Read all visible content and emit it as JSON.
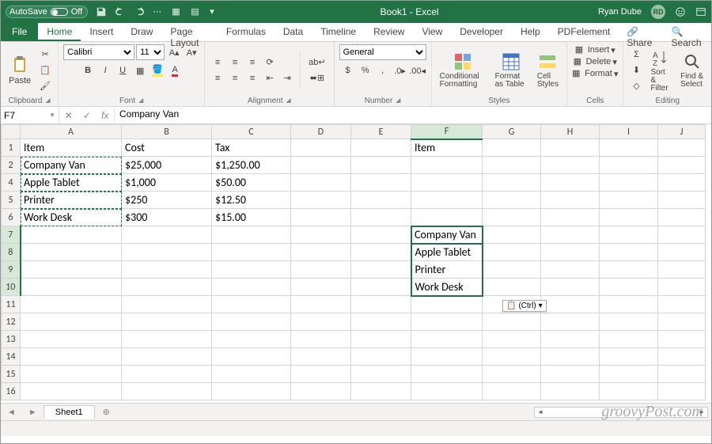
{
  "titlebar": {
    "autosave_label": "AutoSave",
    "autosave_state": "Off",
    "title": "Book1 - Excel",
    "user_name": "Ryan Dube",
    "user_initials": "RD"
  },
  "tabs": {
    "file": "File",
    "items": [
      "Home",
      "Insert",
      "Draw",
      "Page Layout",
      "Formulas",
      "Data",
      "Timeline",
      "Review",
      "View",
      "Developer",
      "Help",
      "PDFelement"
    ],
    "active": "Home",
    "share": "Share",
    "search": "Search"
  },
  "ribbon": {
    "clipboard": {
      "label": "Clipboard",
      "paste": "Paste"
    },
    "font": {
      "label": "Font",
      "name": "Calibri",
      "size": "11"
    },
    "alignment": {
      "label": "Alignment"
    },
    "number": {
      "label": "Number",
      "format": "General"
    },
    "styles": {
      "label": "Styles",
      "cond": "Conditional Formatting",
      "table": "Format as Table",
      "cell": "Cell Styles"
    },
    "cells": {
      "label": "Cells",
      "insert": "Insert",
      "delete": "Delete",
      "format": "Format"
    },
    "editing": {
      "label": "Editing",
      "sort": "Sort & Filter",
      "find": "Find & Select"
    }
  },
  "formula_bar": {
    "name_box": "F7",
    "fx": "fx",
    "value": "Company Van"
  },
  "columns": [
    "A",
    "B",
    "C",
    "D",
    "E",
    "F",
    "G",
    "H",
    "I",
    "J"
  ],
  "rows": [
    "1",
    "2",
    "4",
    "5",
    "6",
    "7",
    "8",
    "9",
    "10",
    "11",
    "12",
    "13",
    "14",
    "15",
    "16"
  ],
  "cells": {
    "A1": "Item",
    "B1": "Cost",
    "C1": "Tax",
    "F1": "Item",
    "A2": "Company Van",
    "B2": "$25,000",
    "C2": "$1,250.00",
    "A4": "Apple Tablet",
    "B4": "$1,000",
    "C4": "$50.00",
    "A5": "Printer",
    "B5": "$250",
    "C5": "$12.50",
    "A6": "Work Desk",
    "B6": "$300",
    "C6": "$15.00",
    "F7": "Company Van",
    "F8": "Apple Tablet",
    "F9": "Printer",
    "F10": "Work Desk"
  },
  "paste_options": {
    "label": "(Ctrl)"
  },
  "sheet": {
    "name": "Sheet1"
  },
  "watermark": "groovyPost.com"
}
